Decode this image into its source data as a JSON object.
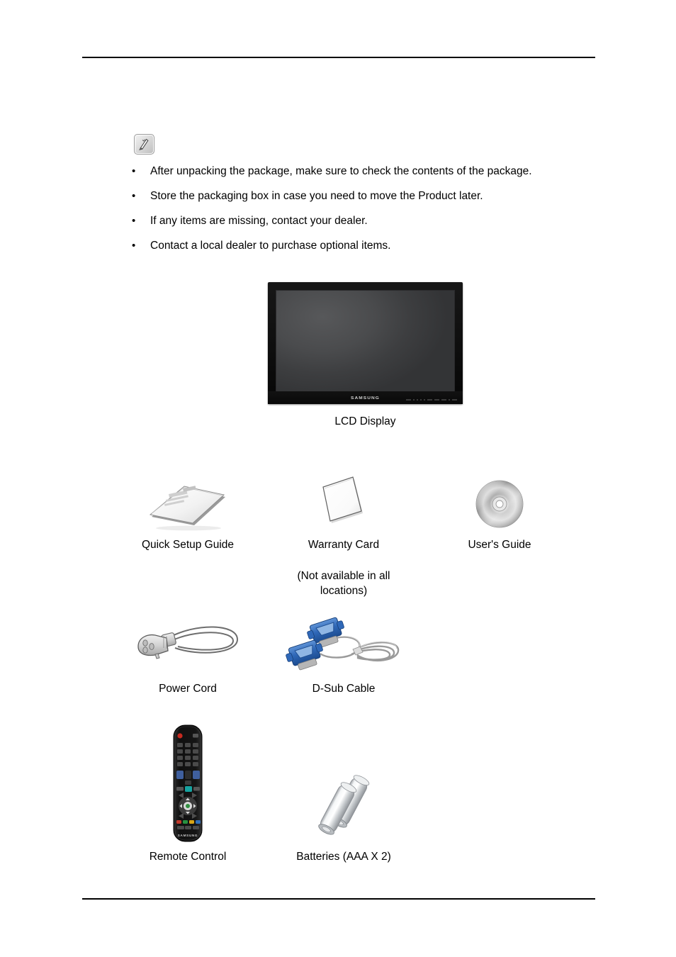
{
  "page": {
    "note_icon_name": "note-pen-icon",
    "rules": {
      "top": true,
      "bottom": true
    }
  },
  "note": {
    "bullets": [
      "After unpacking the package, make sure to check the contents of the package.",
      "Store the packaging box in case you need to move the Product later.",
      "If any items are missing, contact your dealer.",
      "Contact a local dealer to purchase optional items."
    ],
    "bullet_marker": "•"
  },
  "display": {
    "brand_logo": "SAMSUNG",
    "caption": "LCD Display"
  },
  "items": {
    "row1": [
      {
        "label": "Quick Setup Guide",
        "sub": "",
        "art": "booklet"
      },
      {
        "label": "Warranty Card",
        "sub": "(Not available in all locations)",
        "art": "card"
      },
      {
        "label": "User's Guide",
        "sub": "",
        "art": "cd-disc"
      }
    ],
    "row2": [
      {
        "label": "Power Cord",
        "sub": "",
        "art": "power-cord"
      },
      {
        "label": "D-Sub Cable",
        "sub": "",
        "art": "dsub-cable"
      }
    ],
    "row3": [
      {
        "label": "Remote Control",
        "sub": "",
        "art": "remote-control"
      },
      {
        "label": "Batteries (AAA X 2)",
        "sub": "",
        "art": "batteries"
      }
    ]
  },
  "colors": {
    "text": "#000000",
    "rule": "#000000",
    "bezel": "#0d0d0d",
    "screen": "#4a4b4d",
    "connector_blue": "#2a66b5",
    "metal": "#c9ccd0",
    "remote_body": "#1a1a1a"
  }
}
